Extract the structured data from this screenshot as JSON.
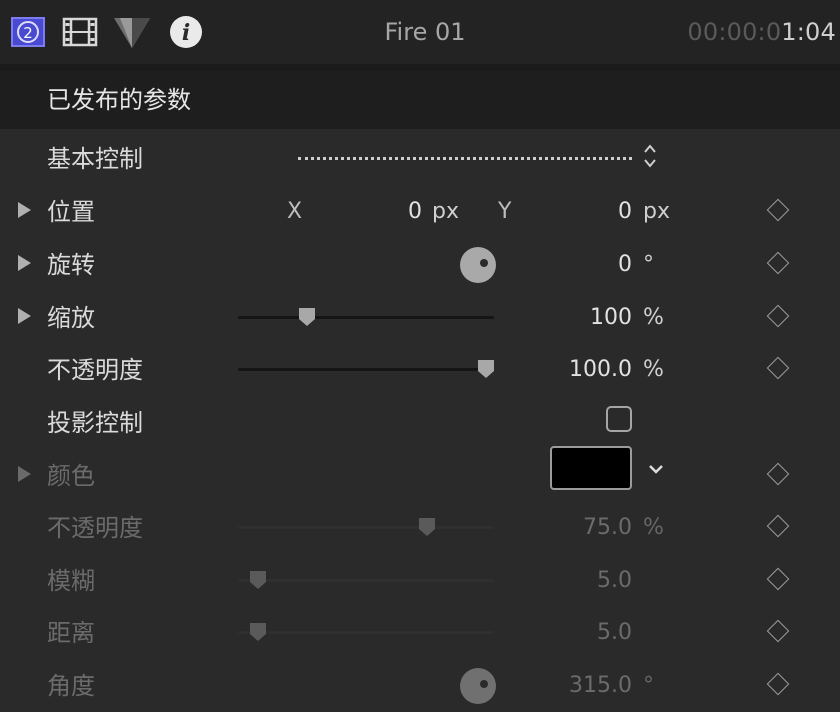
{
  "toolbar": {
    "generator_icon_number": "2",
    "title": "Fire 01",
    "timecode_dim": "00:00:0",
    "timecode_bright": "1:04"
  },
  "section": {
    "title": "已发布的参数"
  },
  "rows": {
    "basic": {
      "label": "基本控制"
    },
    "position": {
      "label": "位置",
      "x_axis": "X",
      "x_value": "0",
      "x_unit": "px",
      "y_axis": "Y",
      "y_value": "0",
      "y_unit": "px"
    },
    "rotation": {
      "label": "旋转",
      "value": "0",
      "unit": "°"
    },
    "scale": {
      "label": "缩放",
      "value": "100",
      "unit": "%",
      "slider_fraction": 0.27
    },
    "opacity": {
      "label": "不透明度",
      "value": "100.0",
      "unit": "%",
      "slider_fraction": 0.97
    },
    "shadow": {
      "label": "投影控制",
      "checked": false
    },
    "color": {
      "label": "颜色",
      "swatch": "#000000"
    },
    "shadow_opacity": {
      "label": "不透明度",
      "value": "75.0",
      "unit": "%",
      "slider_fraction": 0.74
    },
    "blur": {
      "label": "模糊",
      "value": "5.0",
      "slider_fraction": 0.08
    },
    "distance": {
      "label": "距离",
      "value": "5.0",
      "slider_fraction": 0.08
    },
    "angle": {
      "label": "角度",
      "value": "315.0",
      "unit": "°"
    }
  },
  "colors": {
    "accent_icon": "#5b5bd6",
    "background": "#2a2a2a"
  }
}
